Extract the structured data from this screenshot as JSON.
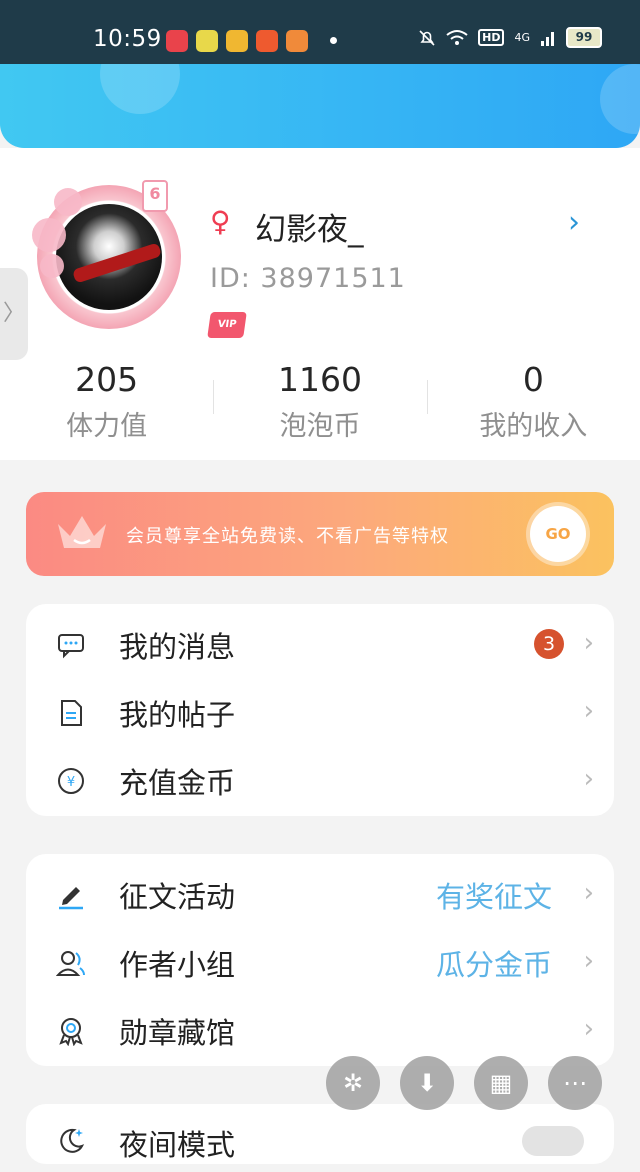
{
  "status_bar": {
    "time": "10:59",
    "network": "4G",
    "hd_label": "HD",
    "battery": "99",
    "app_icon_colors": [
      "#e9434b",
      "#e8d84a",
      "#f0b731",
      "#ee5a2f",
      "#f08a3a"
    ]
  },
  "profile": {
    "level": "6",
    "username": "幻影夜_",
    "id_text": "ID:  38971511",
    "vip_label": "VIP",
    "gender_icon": "female-icon"
  },
  "stats": [
    {
      "value": "205",
      "label": "体力值"
    },
    {
      "value": "1160",
      "label": "泡泡币"
    },
    {
      "value": "0",
      "label": "我的收入"
    }
  ],
  "vip_banner": {
    "text": "会员尊享全站免费读、不看广告等特权",
    "button": "GO"
  },
  "menu_group_1": [
    {
      "label": "我的消息",
      "icon": "message-icon",
      "badge": "3"
    },
    {
      "label": "我的帖子",
      "icon": "document-icon"
    },
    {
      "label": "充值金币",
      "icon": "yuan-coin-icon"
    }
  ],
  "menu_group_2": [
    {
      "label": "征文活动",
      "icon": "pen-icon",
      "extra": "有奖征文"
    },
    {
      "label": "作者小组",
      "icon": "group-icon",
      "extra": "瓜分金币"
    },
    {
      "label": "勋章藏馆",
      "icon": "medal-icon"
    }
  ],
  "bottom_item": {
    "label": "夜间模式",
    "icon": "moon-icon"
  },
  "colors": {
    "accent_blue": "#2ea7f5",
    "badge_red": "#d6522e",
    "link_blue": "#5db3e6"
  }
}
